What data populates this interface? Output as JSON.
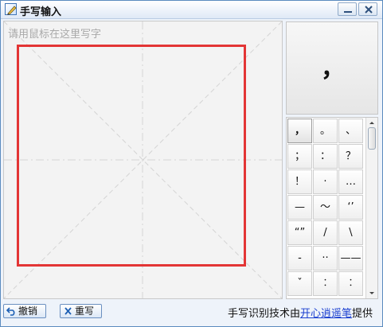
{
  "window": {
    "title": "手写输入"
  },
  "canvas": {
    "hint": "请用鼠标在这里写字"
  },
  "preview": {
    "char": "，"
  },
  "symbols": [
    [
      "，",
      "。",
      "、"
    ],
    [
      "；",
      "：",
      "？"
    ],
    [
      "！",
      "·",
      "…"
    ],
    [
      "—",
      "～",
      "‘’"
    ],
    [
      "“”",
      "/",
      "\\"
    ],
    [
      "-",
      "··",
      "——"
    ],
    [
      "ˇ",
      "︰",
      "︰"
    ]
  ],
  "buttons": {
    "undo_label": "撤销",
    "rewrite_label": "重写"
  },
  "credit": {
    "prefix": "手写识别技术由",
    "link": "开心逍遥笔",
    "suffix": "提供"
  },
  "colors": {
    "frame_red": "#e33535",
    "link_blue": "#1a3fd0"
  }
}
